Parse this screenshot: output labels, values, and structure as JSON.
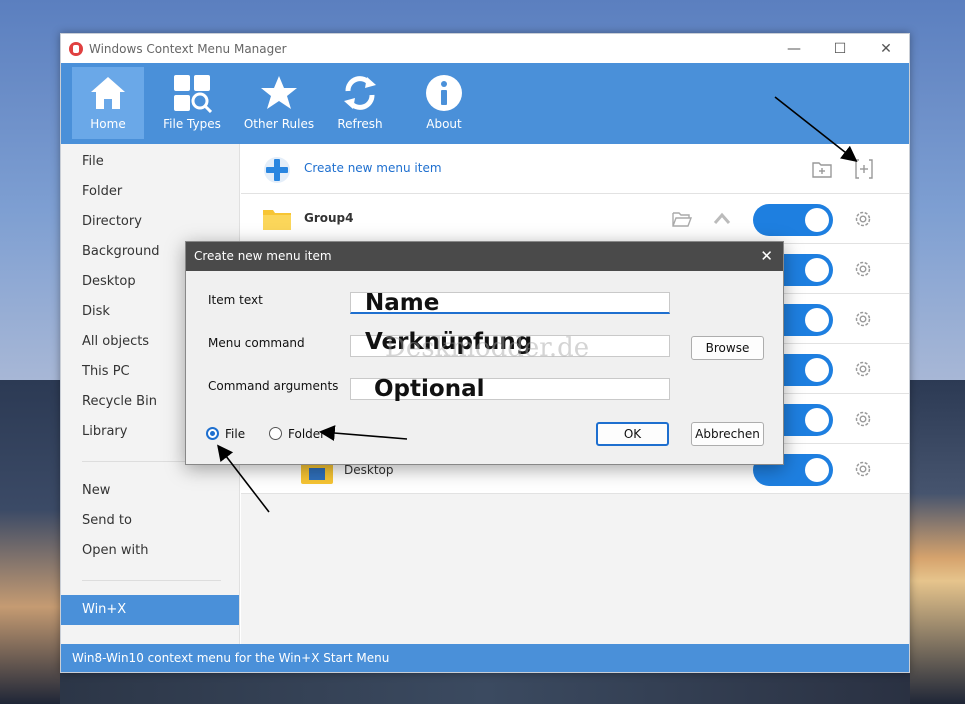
{
  "window": {
    "title": "Windows Context Menu Manager",
    "controls": {
      "minimize": "—",
      "maximize": "☐",
      "close": "✕"
    }
  },
  "toolbar": {
    "items": [
      {
        "label": "Home",
        "icon": "home-icon"
      },
      {
        "label": "File Types",
        "icon": "file-types-icon"
      },
      {
        "label": "Other Rules",
        "icon": "star-icon"
      },
      {
        "label": "Refresh",
        "icon": "refresh-icon"
      },
      {
        "label": "About",
        "icon": "info-icon"
      }
    ],
    "active": "Home"
  },
  "sidebar": {
    "group1": [
      "File",
      "Folder",
      "Directory",
      "Background",
      "Desktop",
      "Disk",
      "All objects",
      "This PC",
      "Recycle Bin",
      "Library"
    ],
    "group2": [
      "New",
      "Send to",
      "Open with"
    ],
    "group3": [
      "Win+X"
    ],
    "selected": "Win+X"
  },
  "main": {
    "create_label": "Create new menu item",
    "rows": [
      {
        "label": "Group4",
        "enabled": true
      },
      {
        "label": "",
        "enabled": true
      },
      {
        "label": "",
        "enabled": true
      },
      {
        "label": "",
        "enabled": true
      },
      {
        "label": "",
        "enabled": true
      },
      {
        "label": "Desktop",
        "enabled": true
      }
    ]
  },
  "status": {
    "text": "Win8-Win10 context menu for the Win+X Start Menu"
  },
  "dialog": {
    "title": "Create new menu item",
    "close": "✕",
    "item_text_label": "Item text",
    "menu_command_label": "Menu command",
    "command_args_label": "Command arguments",
    "browse_label": "Browse",
    "radio_file": "File",
    "radio_folder": "Folder",
    "ok_label": "OK",
    "cancel_label": "Abbrechen",
    "overlay_name": "Name",
    "overlay_link": "Verknüpfung",
    "overlay_optional": "Optional",
    "watermark": "Deskmodder.de"
  },
  "colors": {
    "accent": "#4a90d9",
    "toggle": "#1e7fe0",
    "dialog_title": "#4a4a4a"
  }
}
